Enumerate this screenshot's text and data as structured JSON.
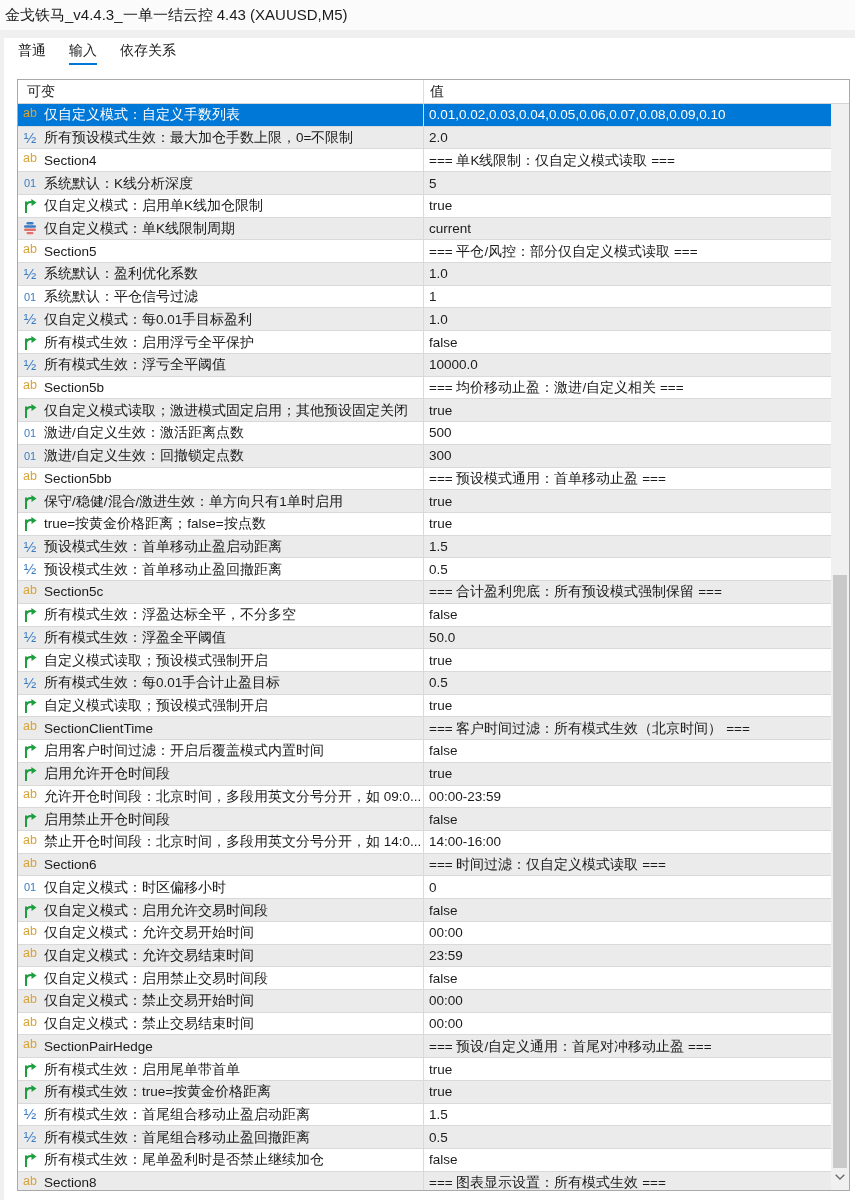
{
  "window": {
    "title": "金戈铁马_v4.4.3_一单一结云控 4.43 (XAUUSD,M5)"
  },
  "tabs": [
    {
      "label": "普通",
      "selected": false
    },
    {
      "label": "输入",
      "selected": true
    },
    {
      "label": "依存关系",
      "selected": false
    }
  ],
  "table": {
    "columns": [
      "可变",
      "值"
    ],
    "rows": [
      {
        "kind": "string",
        "icon": "ab",
        "name": "仅自定义模式：自定义手数列表",
        "value": "0.01,0.02,0.03,0.04,0.05,0.06,0.07,0.08,0.09,0.10",
        "selected": true
      },
      {
        "kind": "double",
        "icon": "½",
        "name": "所有预设模式生效：最大加仓手数上限，0=不限制",
        "value": "2.0",
        "selected": false
      },
      {
        "kind": "string",
        "icon": "ab",
        "name": "Section4",
        "value": "=== 单K线限制：仅自定义模式读取 ===",
        "selected": false
      },
      {
        "kind": "int",
        "icon": "01",
        "name": "系统默认：K线分析深度",
        "value": "5",
        "selected": false
      },
      {
        "kind": "bool",
        "name": "仅自定义模式：启用单K线加仓限制",
        "value": "true",
        "selected": false
      },
      {
        "kind": "enum",
        "name": "仅自定义模式：单K线限制周期",
        "value": "current",
        "selected": false
      },
      {
        "kind": "string",
        "icon": "ab",
        "name": "Section5",
        "value": "=== 平仓/风控：部分仅自定义模式读取 ===",
        "selected": false
      },
      {
        "kind": "double",
        "icon": "½",
        "name": "系统默认：盈利优化系数",
        "value": "1.0",
        "selected": false
      },
      {
        "kind": "int",
        "icon": "01",
        "name": "系统默认：平仓信号过滤",
        "value": "1",
        "selected": false
      },
      {
        "kind": "double",
        "icon": "½",
        "name": "仅自定义模式：每0.01手目标盈利",
        "value": "1.0",
        "selected": false
      },
      {
        "kind": "bool",
        "name": "所有模式生效：启用浮亏全平保护",
        "value": "false",
        "selected": false
      },
      {
        "kind": "double",
        "icon": "½",
        "name": "所有模式生效：浮亏全平阈值",
        "value": "10000.0",
        "selected": false
      },
      {
        "kind": "string",
        "icon": "ab",
        "name": "Section5b",
        "value": "=== 均价移动止盈：激进/自定义相关 ===",
        "selected": false
      },
      {
        "kind": "bool",
        "name": "仅自定义模式读取；激进模式固定启用；其他预设固定关闭",
        "value": "true",
        "selected": false
      },
      {
        "kind": "int",
        "icon": "01",
        "name": "激进/自定义生效：激活距离点数",
        "value": "500",
        "selected": false
      },
      {
        "kind": "int",
        "icon": "01",
        "name": "激进/自定义生效：回撤锁定点数",
        "value": "300",
        "selected": false
      },
      {
        "kind": "string",
        "icon": "ab",
        "name": "Section5bb",
        "value": "=== 预设模式通用：首单移动止盈 ===",
        "selected": false
      },
      {
        "kind": "bool",
        "name": "保守/稳健/混合/激进生效：单方向只有1单时启用",
        "value": "true",
        "selected": false
      },
      {
        "kind": "bool",
        "name": "true=按黄金价格距离；false=按点数",
        "value": "true",
        "selected": false
      },
      {
        "kind": "double",
        "icon": "½",
        "name": "预设模式生效：首单移动止盈启动距离",
        "value": "1.5",
        "selected": false
      },
      {
        "kind": "double",
        "icon": "½",
        "name": "预设模式生效：首单移动止盈回撤距离",
        "value": "0.5",
        "selected": false
      },
      {
        "kind": "string",
        "icon": "ab",
        "name": "Section5c",
        "value": "=== 合计盈利兜底：所有预设模式强制保留 ===",
        "selected": false
      },
      {
        "kind": "bool",
        "name": "所有模式生效：浮盈达标全平，不分多空",
        "value": "false",
        "selected": false
      },
      {
        "kind": "double",
        "icon": "½",
        "name": "所有模式生效：浮盈全平阈值",
        "value": "50.0",
        "selected": false
      },
      {
        "kind": "bool",
        "name": "自定义模式读取；预设模式强制开启",
        "value": "true",
        "selected": false
      },
      {
        "kind": "double",
        "icon": "½",
        "name": "所有模式生效：每0.01手合计止盈目标",
        "value": "0.5",
        "selected": false
      },
      {
        "kind": "bool",
        "name": "自定义模式读取；预设模式强制开启",
        "value": "true",
        "selected": false
      },
      {
        "kind": "string",
        "icon": "ab",
        "name": "SectionClientTime",
        "value": "=== 客户时间过滤：所有模式生效（北京时间） ===",
        "selected": false
      },
      {
        "kind": "bool",
        "name": "启用客户时间过滤：开启后覆盖模式内置时间",
        "value": "false",
        "selected": false
      },
      {
        "kind": "bool",
        "name": "启用允许开仓时间段",
        "value": "true",
        "selected": false
      },
      {
        "kind": "string",
        "icon": "ab",
        "name": "允许开仓时间段：北京时间，多段用英文分号分开，如 09:0...",
        "value": "00:00-23:59",
        "selected": false
      },
      {
        "kind": "bool",
        "name": "启用禁止开仓时间段",
        "value": "false",
        "selected": false
      },
      {
        "kind": "string",
        "icon": "ab",
        "name": "禁止开仓时间段：北京时间，多段用英文分号分开，如 14:0...",
        "value": "14:00-16:00",
        "selected": false
      },
      {
        "kind": "string",
        "icon": "ab",
        "name": "Section6",
        "value": "=== 时间过滤：仅自定义模式读取 ===",
        "selected": false
      },
      {
        "kind": "int",
        "icon": "01",
        "name": "仅自定义模式：时区偏移小时",
        "value": "0",
        "selected": false
      },
      {
        "kind": "bool",
        "name": "仅自定义模式：启用允许交易时间段",
        "value": "false",
        "selected": false
      },
      {
        "kind": "string",
        "icon": "ab",
        "name": "仅自定义模式：允许交易开始时间",
        "value": "00:00",
        "selected": false
      },
      {
        "kind": "string",
        "icon": "ab",
        "name": "仅自定义模式：允许交易结束时间",
        "value": "23:59",
        "selected": false
      },
      {
        "kind": "bool",
        "name": "仅自定义模式：启用禁止交易时间段",
        "value": "false",
        "selected": false
      },
      {
        "kind": "string",
        "icon": "ab",
        "name": "仅自定义模式：禁止交易开始时间",
        "value": "00:00",
        "selected": false
      },
      {
        "kind": "string",
        "icon": "ab",
        "name": "仅自定义模式：禁止交易结束时间",
        "value": "00:00",
        "selected": false
      },
      {
        "kind": "string",
        "icon": "ab",
        "name": "SectionPairHedge",
        "value": "=== 预设/自定义通用：首尾对冲移动止盈 ===",
        "selected": false
      },
      {
        "kind": "bool",
        "name": "所有模式生效：启用尾单带首单",
        "value": "true",
        "selected": false
      },
      {
        "kind": "bool",
        "name": "所有模式生效：true=按黄金价格距离",
        "value": "true",
        "selected": false
      },
      {
        "kind": "double",
        "icon": "½",
        "name": "所有模式生效：首尾组合移动止盈启动距离",
        "value": "1.5",
        "selected": false
      },
      {
        "kind": "double",
        "icon": "½",
        "name": "所有模式生效：首尾组合移动止盈回撤距离",
        "value": "0.5",
        "selected": false
      },
      {
        "kind": "bool",
        "name": "所有模式生效：尾单盈利时是否禁止继续加仓",
        "value": "false",
        "selected": false
      },
      {
        "kind": "string",
        "icon": "ab",
        "name": "Section8",
        "value": "=== 图表显示设置：所有模式生效 ===",
        "selected": false
      }
    ]
  }
}
